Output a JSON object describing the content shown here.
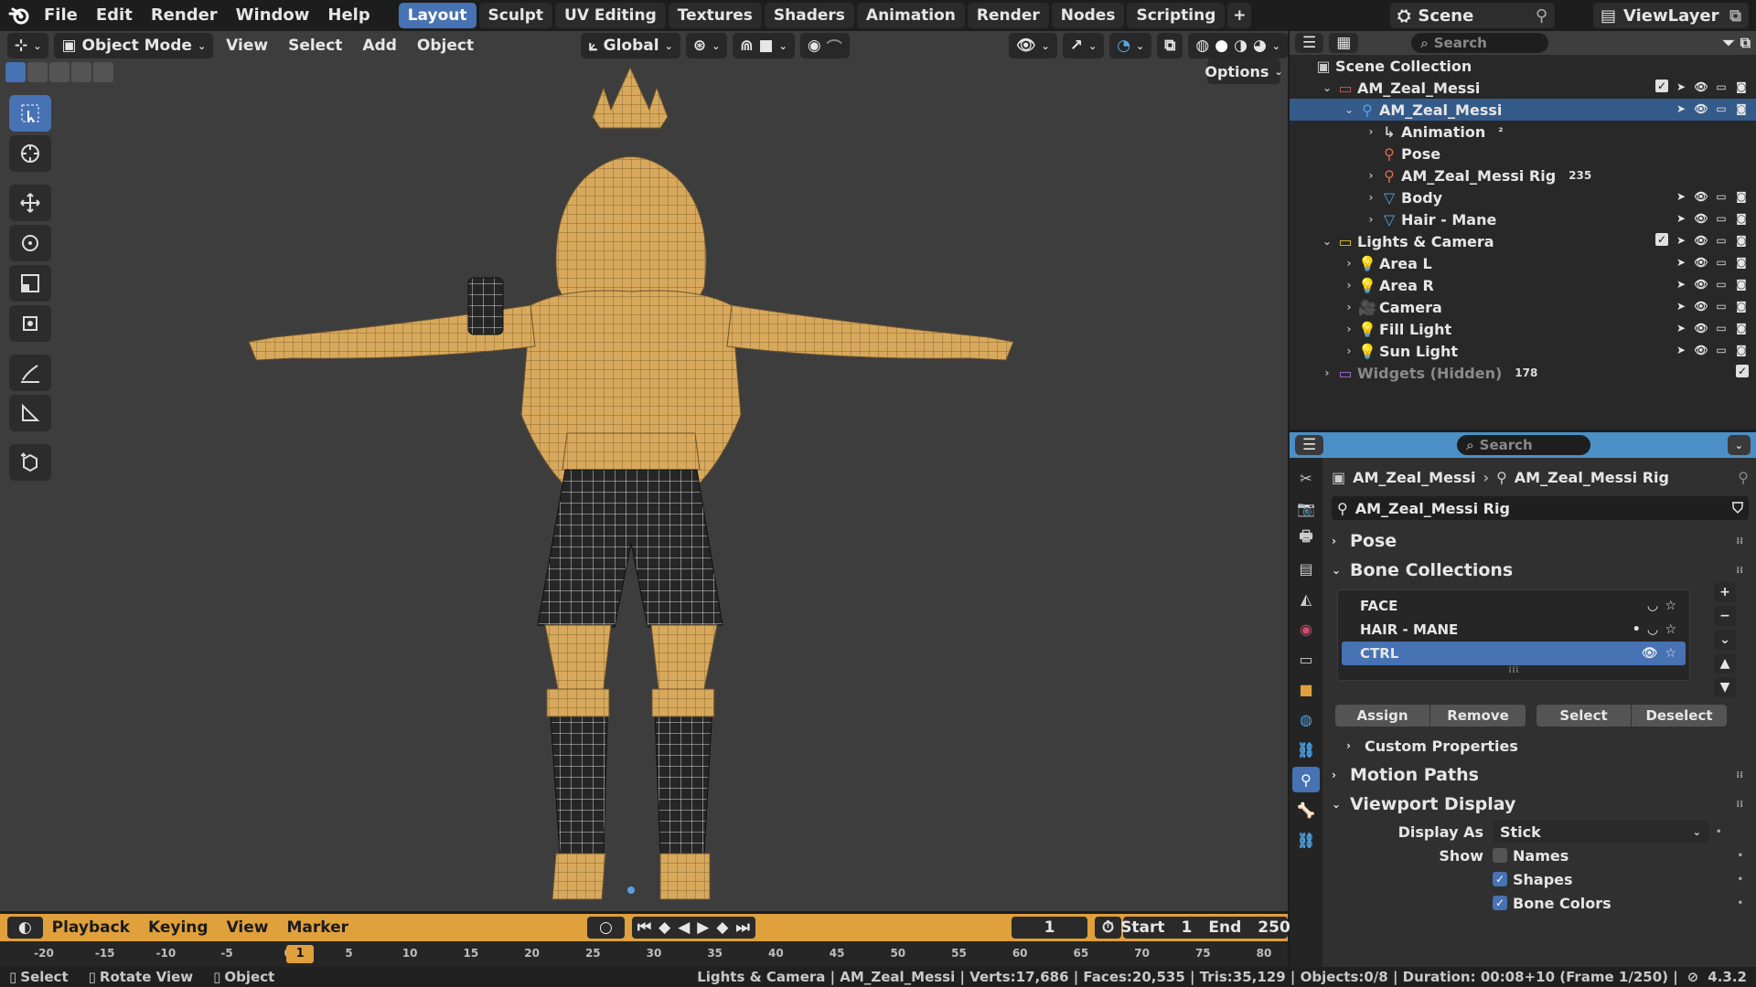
{
  "topbar": {
    "menus": [
      "File",
      "Edit",
      "Render",
      "Window",
      "Help"
    ],
    "tabs": [
      "Layout",
      "Sculpt",
      "UV Editing",
      "Textures",
      "Shaders",
      "Animation",
      "Render",
      "Nodes",
      "Scripting"
    ],
    "active_tab": "Layout",
    "scene": "Scene",
    "view_layer": "ViewLayer"
  },
  "viewport": {
    "mode": "Object Mode",
    "menus": [
      "View",
      "Select",
      "Add",
      "Object"
    ],
    "orientation": "Global",
    "options": "Options"
  },
  "outliner": {
    "search_placeholder": "Search",
    "scene_collection": "Scene Collection",
    "rows": [
      {
        "label": "AM_Zeal_Messi",
        "indent": 1,
        "arrow": "v",
        "type": "collection",
        "right": "full"
      },
      {
        "label": "AM_Zeal_Messi",
        "indent": 2,
        "arrow": "v",
        "type": "armature",
        "right": "noChk",
        "selected": true
      },
      {
        "label": "Animation",
        "indent": 3,
        "arrow": ">",
        "type": "anim",
        "extra": "²"
      },
      {
        "label": "Pose",
        "indent": 3,
        "arrow": "",
        "type": "pose"
      },
      {
        "label": "AM_Zeal_Messi Rig",
        "indent": 3,
        "arrow": ">",
        "type": "pose",
        "extra": "235"
      },
      {
        "label": "Body",
        "indent": 3,
        "arrow": ">",
        "type": "mesh",
        "right": "noChk"
      },
      {
        "label": "Hair - Mane",
        "indent": 3,
        "arrow": ">",
        "type": "mesh",
        "right": "noChk"
      },
      {
        "label": "Lights & Camera",
        "indent": 1,
        "arrow": "v",
        "type": "collection-y",
        "right": "full"
      },
      {
        "label": "Area L",
        "indent": 2,
        "arrow": ">",
        "type": "light",
        "right": "noChk"
      },
      {
        "label": "Area R",
        "indent": 2,
        "arrow": ">",
        "type": "light",
        "right": "noChk"
      },
      {
        "label": "Camera",
        "indent": 2,
        "arrow": ">",
        "type": "camera",
        "right": "noChk"
      },
      {
        "label": "Fill Light",
        "indent": 2,
        "arrow": ">",
        "type": "light",
        "right": "noChk"
      },
      {
        "label": "Sun Light",
        "indent": 2,
        "arrow": ">",
        "type": "light",
        "right": "noChk"
      },
      {
        "label": "Widgets (Hidden)",
        "indent": 1,
        "arrow": ">",
        "type": "collection-p",
        "right": "chkOnly",
        "dim": true,
        "extra": "178"
      }
    ]
  },
  "properties": {
    "search_placeholder": "Search",
    "breadcrumb": [
      "AM_Zeal_Messi",
      "AM_Zeal_Messi Rig"
    ],
    "data_name": "AM_Zeal_Messi Rig",
    "panels": {
      "pose": "Pose",
      "bone_collections": "Bone Collections",
      "custom_properties": "Custom Properties",
      "motion_paths": "Motion Paths",
      "viewport_display": "Viewport Display"
    },
    "bone_collections": [
      "FACE",
      "HAIR - MANE",
      "CTRL"
    ],
    "active_collection": "CTRL",
    "buttons": [
      "Assign",
      "Remove",
      "Select",
      "Deselect"
    ],
    "display_as_label": "Display As",
    "display_as_value": "Stick",
    "show_label": "Show",
    "show_options": [
      {
        "label": "Names",
        "checked": false
      },
      {
        "label": "Shapes",
        "checked": true
      },
      {
        "label": "Bone Colors",
        "checked": true
      }
    ]
  },
  "timeline": {
    "menus": [
      "Playback",
      "Keying",
      "View",
      "Marker"
    ],
    "current_frame": "1",
    "start_label": "Start",
    "start": "1",
    "end_label": "End",
    "end": "250",
    "ticks": [
      "-20",
      "-15",
      "-10",
      "-5",
      "0",
      "5",
      "10",
      "15",
      "20",
      "25",
      "30",
      "35",
      "40",
      "45",
      "50",
      "55",
      "60",
      "65",
      "70",
      "75",
      "80"
    ]
  },
  "statusbar": {
    "hints": [
      "Select",
      "Rotate View",
      "Object"
    ],
    "info": "Lights & Camera | AM_Zeal_Messi | Verts:17,686 | Faces:20,535 | Tris:35,129 | Objects:0/8 | Duration: 00:08+10 (Frame 1/250) |",
    "version": "4.3.2"
  },
  "colors": {
    "accent": "#4772b3",
    "timeline": "#e0a03c",
    "wire_skin": "#d9a85a",
    "viewport_bg": "#3d3d3d"
  }
}
